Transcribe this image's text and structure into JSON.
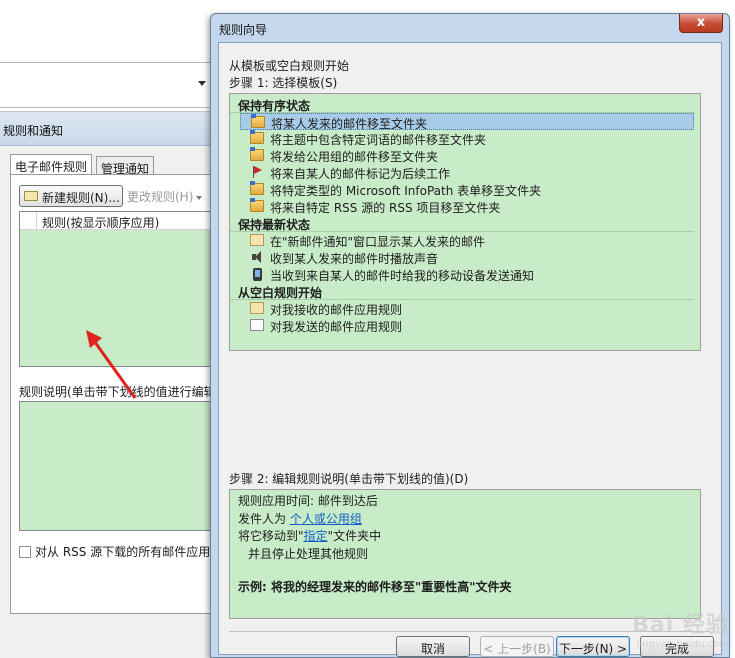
{
  "background": {
    "window_title": "规则和通知",
    "tabs": [
      {
        "label": "电子邮件规则",
        "active": true
      },
      {
        "label": "管理通知",
        "active": false
      }
    ],
    "toolbar": {
      "new_rule": "新建规则(N)...",
      "change_rule": "更改规则(H)"
    },
    "rules_column": "规则(按显示顺序应用)",
    "description_label": "规则说明(单击带下划线的值进行编辑",
    "rss_checkbox": "对从 RSS 源下载的所有邮件应用"
  },
  "wizard": {
    "title": "规则向导",
    "close_glyph": "x",
    "intro": "从模板或空白规则开始",
    "step1": "步骤 1: 选择模板(S)",
    "groups": [
      {
        "label": "保持有序状态",
        "items": [
          {
            "label": "将某人发来的邮件移至文件夹",
            "icon": "folder",
            "selected": true
          },
          {
            "label": "将主题中包含特定词语的邮件移至文件夹",
            "icon": "folder",
            "selected": false
          },
          {
            "label": "将发给公用组的邮件移至文件夹",
            "icon": "folder",
            "selected": false
          },
          {
            "label": "将来自某人的邮件标记为后续工作",
            "icon": "flag",
            "selected": false
          },
          {
            "label": "将特定类型的 Microsoft InfoPath 表单移至文件夹",
            "icon": "folder",
            "selected": false
          },
          {
            "label": "将来自特定 RSS 源的 RSS 项目移至文件夹",
            "icon": "folder",
            "selected": false
          }
        ]
      },
      {
        "label": "保持最新状态",
        "items": [
          {
            "label": "在\"新邮件通知\"窗口显示某人发来的邮件",
            "icon": "mail",
            "selected": false
          },
          {
            "label": "收到某人发来的邮件时播放声音",
            "icon": "speaker",
            "selected": false
          },
          {
            "label": "当收到来自某人的邮件时给我的移动设备发送通知",
            "icon": "phone",
            "selected": false
          }
        ]
      },
      {
        "label": "从空白规则开始",
        "items": [
          {
            "label": "对我接收的邮件应用规则",
            "icon": "mail",
            "selected": false
          },
          {
            "label": "对我发送的邮件应用规则",
            "icon": "envelope",
            "selected": false
          }
        ]
      }
    ],
    "step2": "步骤 2: 编辑规则说明(单击带下划线的值)(D)",
    "description": {
      "line1": "规则应用时间: 邮件到达后",
      "line2_prefix": "发件人为 ",
      "line2_link": "个人或公用组",
      "line3_prefix": "将它移动到\"",
      "line3_link": "指定",
      "line3_suffix": "\"文件夹中",
      "line4": "并且停止处理其他规则",
      "example": "示例: 将我的经理发来的邮件移至\"重要性高\"文件夹"
    },
    "buttons": {
      "cancel": "取消",
      "back": "< 上一步(B)",
      "next": "下一步(N) >",
      "finish": "完成"
    }
  },
  "watermark": {
    "text": "Bai 经验",
    "sub": "jingyan.baidu.com"
  }
}
